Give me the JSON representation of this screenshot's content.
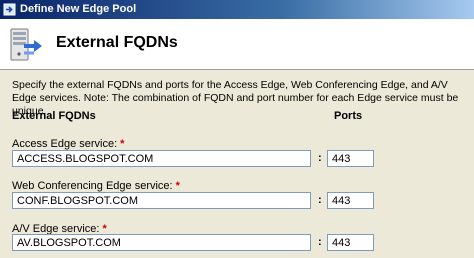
{
  "window": {
    "title": "Define New Edge Pool"
  },
  "header": {
    "title": "External FQDNs",
    "icon": "server-arrow-icon"
  },
  "description": "Specify the external FQDNs and ports for the Access Edge, Web Conferencing Edge, and A/V Edge services. Note: The combination of FQDN and port number for each Edge service must be unique.",
  "columns": {
    "fqdn": "External FQDNs",
    "ports": "Ports"
  },
  "required_marker": "*",
  "separator": ":",
  "fields": {
    "access": {
      "label": "Access Edge service:",
      "fqdn": "ACCESS.BLOGSPOT.COM",
      "port": "443"
    },
    "webconf": {
      "label": "Web Conferencing Edge service:",
      "fqdn": "CONF.BLOGSPOT.COM",
      "port": "443"
    },
    "av": {
      "label": "A/V Edge service:",
      "fqdn": "AV.BLOGSPOT.COM",
      "port": "443"
    }
  },
  "colors": {
    "required": "#d00000",
    "title_bar": "#0a246a",
    "header_bg": "#ffffff",
    "content_bg": "#ece9d8"
  }
}
